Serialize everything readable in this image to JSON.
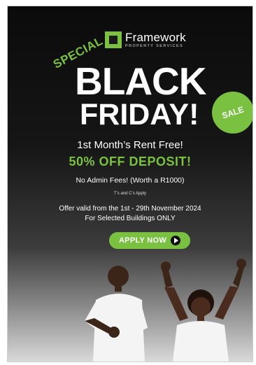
{
  "brand": {
    "name": "Framework",
    "subtitle": "PROPERTY SERVICES"
  },
  "headline": {
    "special": "SPECIAL",
    "black": "BLACK",
    "friday": "FRIDAY!",
    "sale_badge": "SALE"
  },
  "offer": {
    "rent": "1st Month’s Rent Free!",
    "deposit": "50% OFF DEPOSIT!",
    "admin": "No Admin Fees! (Worth a R1000)",
    "terms": "T’s and C’s Apply",
    "validity": "Offer valid from the 1st - 29th November 2024",
    "scope": "For Selected Buildings ONLY"
  },
  "cta": {
    "label": "APPLY NOW"
  },
  "colors": {
    "accent": "#7ac142",
    "background": "#111111"
  }
}
